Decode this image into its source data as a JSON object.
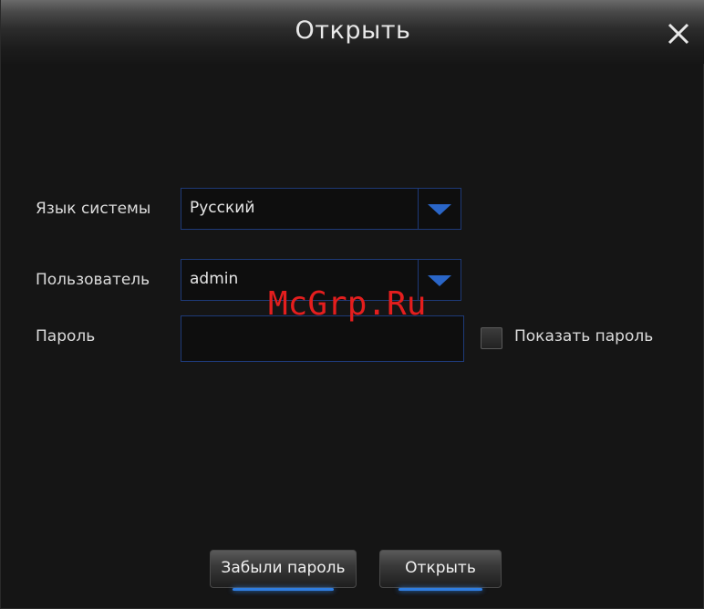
{
  "dialog": {
    "title": "Открыть",
    "close_icon": "close-icon"
  },
  "form": {
    "language": {
      "label": "Язык системы",
      "value": "Русский"
    },
    "user": {
      "label": "Пользователь",
      "value": "admin"
    },
    "password": {
      "label": "Пароль",
      "value": ""
    },
    "show_password": {
      "label": "Показать пароль",
      "checked": false
    }
  },
  "watermark": "McGrp.Ru",
  "buttons": {
    "forgot_label": "Забыли пароль",
    "open_label": "Открыть"
  },
  "colors": {
    "accent": "#2a66c8",
    "field_border": "#1e3a78",
    "watermark": "#e41e1e"
  }
}
